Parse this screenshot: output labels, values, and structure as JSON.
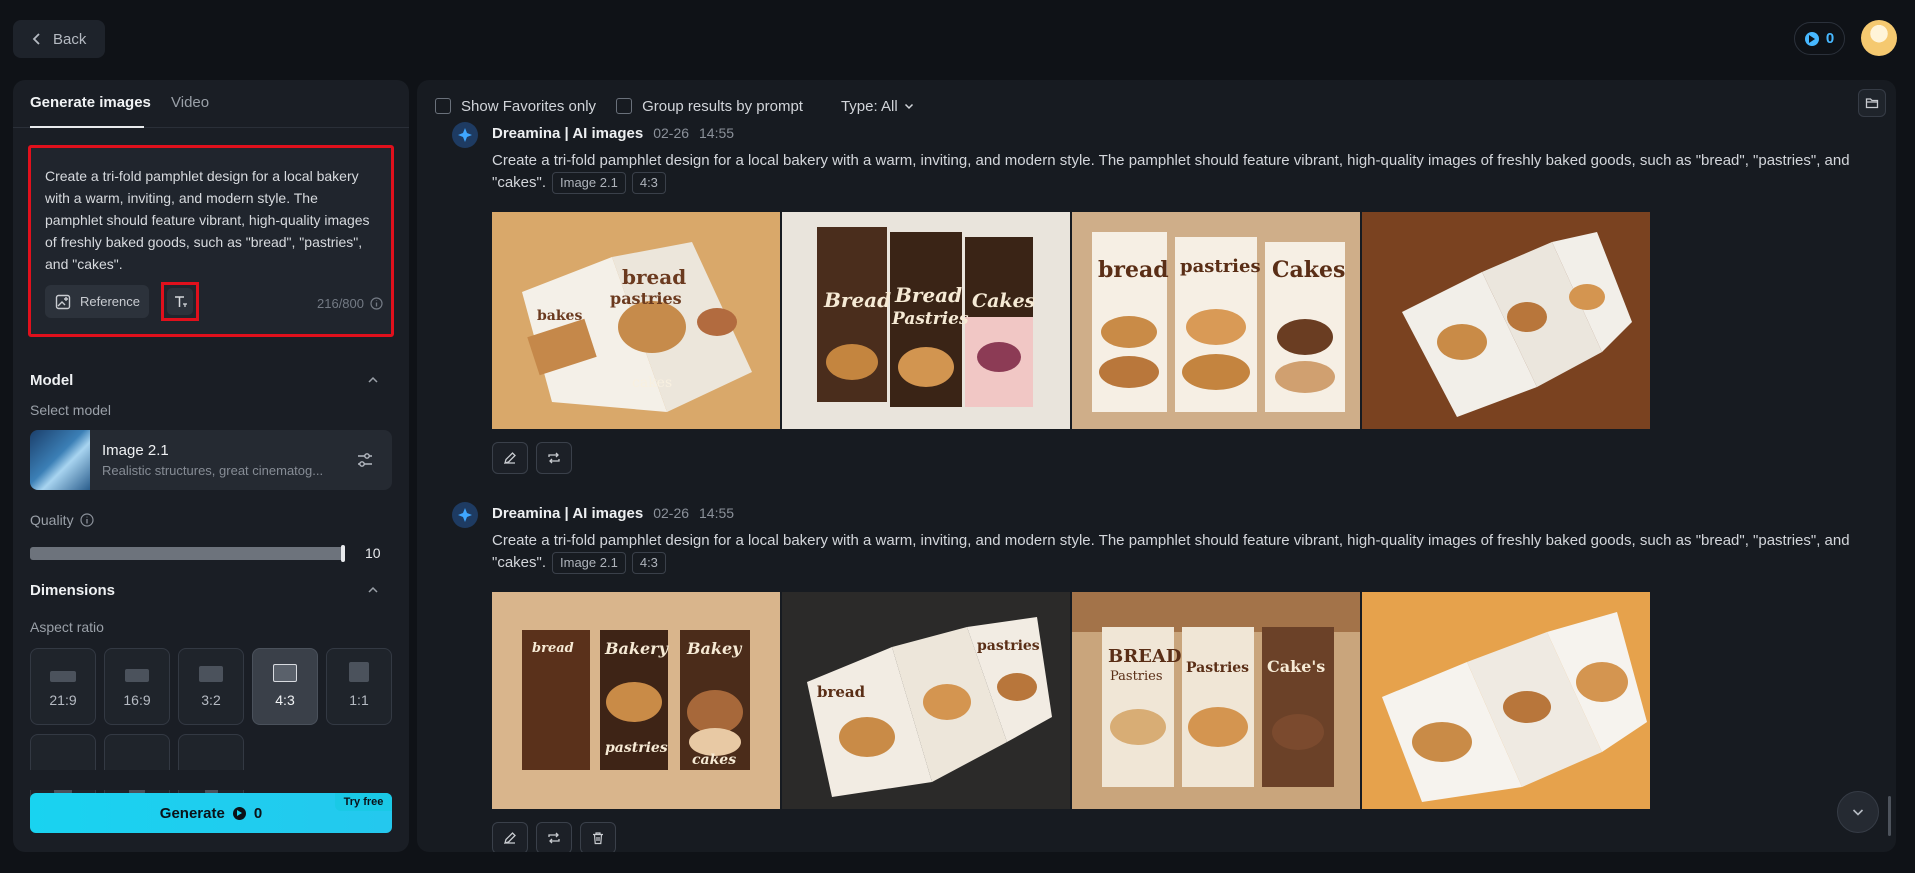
{
  "topbar": {
    "back_label": "Back",
    "credits": "0"
  },
  "left": {
    "tabs": [
      {
        "label": "Generate images",
        "active": true
      },
      {
        "label": "Video",
        "active": false
      }
    ],
    "prompt": {
      "text": "Create a tri-fold pamphlet design for a local bakery with a warm, inviting, and modern style. The pamphlet should feature vibrant, high-quality images of freshly baked goods, such as \"bread\", \"pastries\", and \"cakes\".",
      "reference_label": "Reference",
      "char_count": "216/800"
    },
    "model": {
      "section_title": "Model",
      "select_label": "Select model",
      "name": "Image 2.1",
      "description": "Realistic structures, great cinematog..."
    },
    "quality": {
      "label": "Quality",
      "value": "10",
      "fraction": 1.0
    },
    "dimensions": {
      "section_title": "Dimensions",
      "aspect_label": "Aspect ratio",
      "ratios": [
        {
          "label": "21:9",
          "active": false
        },
        {
          "label": "16:9",
          "active": false
        },
        {
          "label": "3:2",
          "active": false
        },
        {
          "label": "4:3",
          "active": true
        },
        {
          "label": "1:1",
          "active": false
        }
      ]
    },
    "generate": {
      "label": "Generate",
      "cost": "0",
      "badge": "Try free"
    }
  },
  "right": {
    "filters": {
      "favorites": "Show Favorites only",
      "group_by_prompt": "Group results by prompt",
      "type": "Type: All"
    },
    "groups": [
      {
        "source": "Dreamina | AI images",
        "date": "02-26",
        "time": "14:55",
        "prompt": "Create a tri-fold pamphlet design for a local bakery with a warm, inviting, and modern style. The pamphlet should feature vibrant, high-quality images of freshly baked goods, such as \"bread\", \"pastries\", and \"cakes\".",
        "tags": [
          "Image 2.1",
          "4:3"
        ],
        "images": [
          {
            "words": [
              "bread",
              "pastries",
              "bakes",
              "cakes"
            ]
          },
          {
            "words": [
              "Bread",
              "Bread",
              "Pastries",
              "Cakes"
            ]
          },
          {
            "words": [
              "bread",
              "pastries",
              "Cakes"
            ]
          },
          {
            "words": []
          }
        ]
      },
      {
        "source": "Dreamina | AI images",
        "date": "02-26",
        "time": "14:55",
        "prompt": "Create a tri-fold pamphlet design for a local bakery with a warm, inviting, and modern style. The pamphlet should feature vibrant, high-quality images of freshly baked goods, such as \"bread\", \"pastries\", and \"cakes\".",
        "tags": [
          "Image 2.1",
          "4:3"
        ],
        "images": [
          {
            "words": [
              "bread",
              "Bakery",
              "Bakey",
              "pastries",
              "cakes"
            ]
          },
          {
            "words": [
              "bread",
              "pastries"
            ]
          },
          {
            "words": [
              "BREAD",
              "Pastries",
              "Pastries",
              "Cake's"
            ]
          },
          {
            "words": []
          }
        ]
      }
    ]
  }
}
